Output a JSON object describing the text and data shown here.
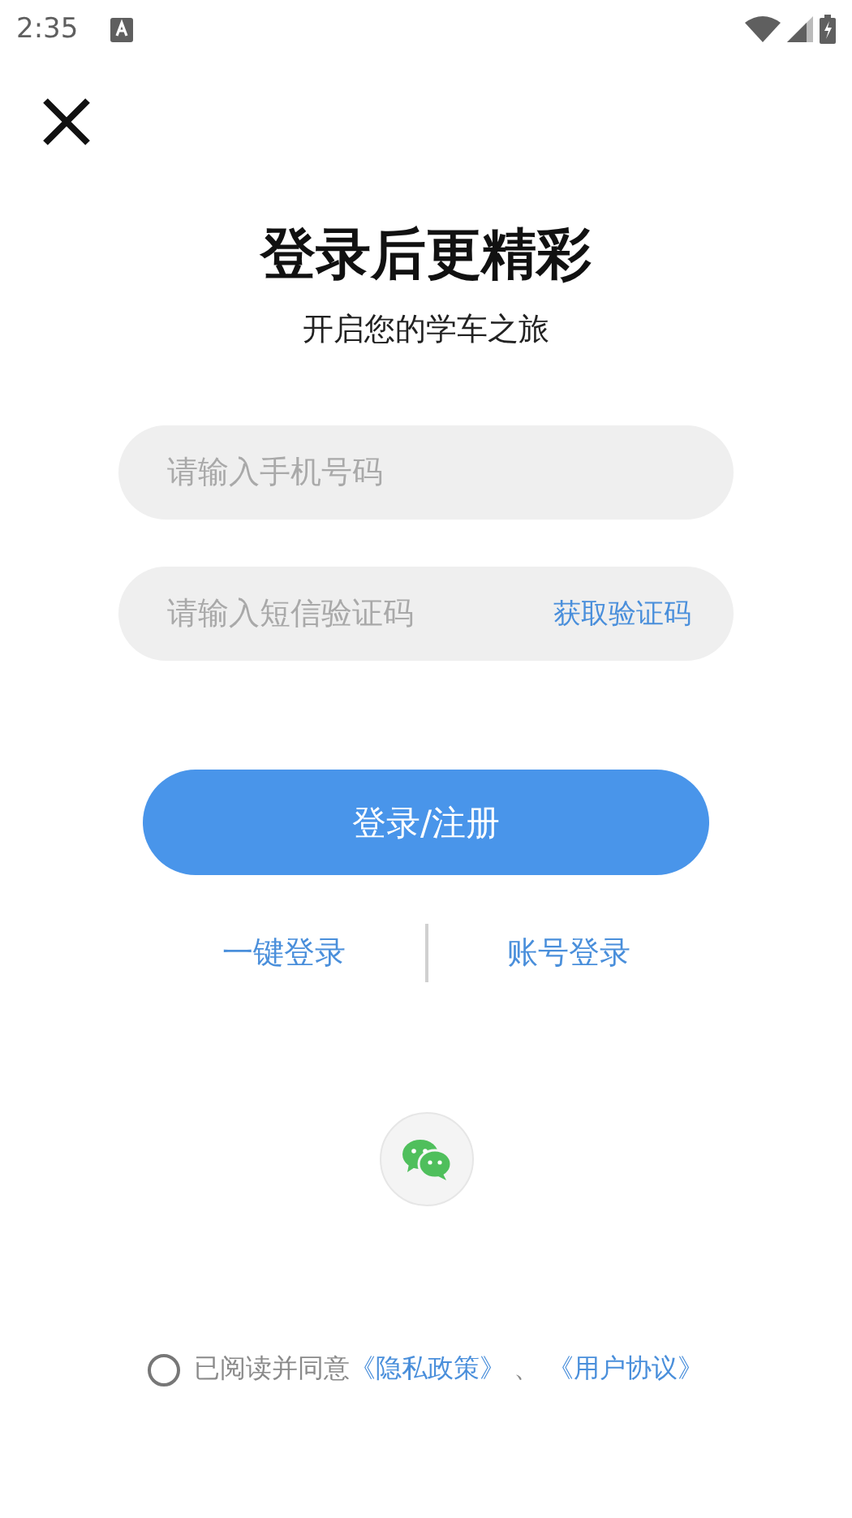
{
  "status_bar": {
    "time": "2:35"
  },
  "header": {
    "title": "登录后更精彩",
    "subtitle": "开启您的学车之旅"
  },
  "fields": [
    {
      "kind": "phone",
      "placeholder": "请输入手机号码"
    },
    {
      "kind": "code",
      "placeholder": "请输入短信验证码",
      "action": "获取验证码"
    }
  ],
  "submit_button": "登录/注册",
  "alt_logins": [
    "一键登录",
    "账号登录"
  ],
  "agreement": {
    "checked": false,
    "text": "已阅读并同意",
    "links": [
      "《隐私政策》",
      "《用户协议》"
    ],
    "separator": "、"
  }
}
